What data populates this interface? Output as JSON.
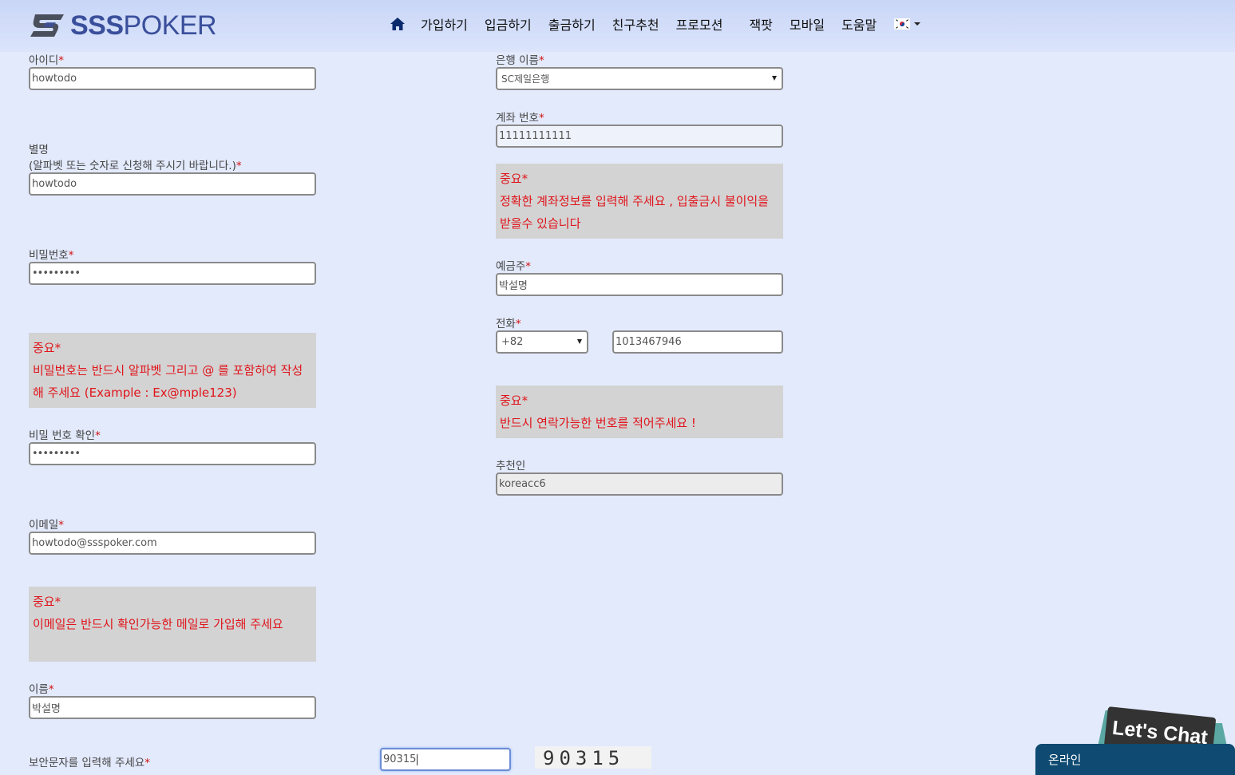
{
  "header": {
    "logo": {
      "sss": "SSS",
      "poker": "POKER"
    },
    "nav": [
      {
        "label": "가입하기"
      },
      {
        "label": "입금하기"
      },
      {
        "label": "출금하기"
      },
      {
        "label": "친구추천"
      },
      {
        "label": "프로모션"
      },
      {
        "label": "잭팟"
      },
      {
        "label": "모바일"
      },
      {
        "label": "도움말"
      }
    ],
    "language_icon": "korea-flag-icon"
  },
  "form": {
    "user_id": {
      "label": "아이디",
      "value": "howtodo"
    },
    "nickname": {
      "label": "별명",
      "note": "(알파벳 또는 숫자로 신청해 주시기 바랍니다.)",
      "value": "howtodo"
    },
    "password": {
      "label": "비밀번호",
      "value": "•••••••••"
    },
    "password_warning": {
      "title": "중요*",
      "text": "비밀번호는 반드시 알파벳 그리고 @ 를 포함하여 작성해 주세요 (Example : Ex@mple123)"
    },
    "password_confirm": {
      "label": "비밀 번호 확인",
      "value": "•••••••••"
    },
    "email": {
      "label": "이메일",
      "value": "howtodo@ssspoker.com"
    },
    "email_warning": {
      "title": "중요*",
      "text": "이메일은 반드시 확인가능한 메일로 가입해 주세요"
    },
    "name": {
      "label": "이름",
      "value": "박설명"
    },
    "captcha": {
      "label": "보안문자를 입력해 주세요",
      "value": "90315",
      "image_text": "90315"
    },
    "bank_name": {
      "label": "은행 이름",
      "value": "SC제일은행"
    },
    "account_number": {
      "label": "계좌 번호",
      "value": "11111111111"
    },
    "account_warning": {
      "title": "중요*",
      "text": "정확한 계좌정보를 입력해 주세요 , 입출금시 불이익을 받을수 있습니다"
    },
    "depositor": {
      "label": "예금주",
      "value": "박설명"
    },
    "phone": {
      "label": "전화",
      "country_code": "+82",
      "number": "1013467946"
    },
    "phone_warning": {
      "title": "중요*",
      "text": "반드시 연락가능한 번호를 적어주세요 !"
    },
    "referrer": {
      "label": "추천인",
      "value": "koreacc6"
    },
    "required_mark": "*"
  },
  "chat": {
    "badge": "Let's Chat",
    "status": "온라인"
  },
  "colors": {
    "required": "#d01010",
    "warning_text": "#e0141b",
    "warning_bg": "#d3d3d3",
    "brand": "#3a4f9b",
    "chat_bar": "#0e4a71"
  }
}
